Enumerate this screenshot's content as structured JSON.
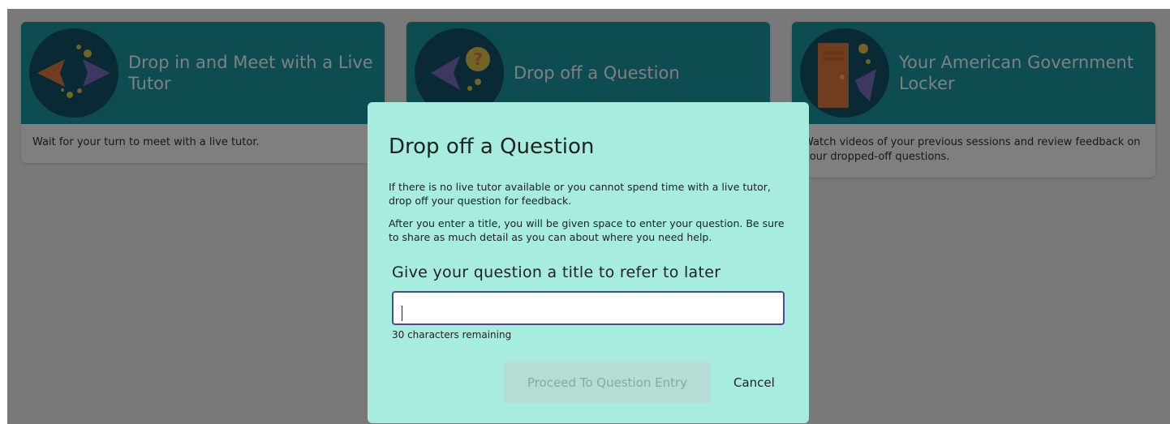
{
  "cards": [
    {
      "title": "Drop in and Meet with a Live Tutor",
      "description": "Wait for your turn to meet with a live tutor.",
      "icon": "fish-meet-icon"
    },
    {
      "title": "Drop off a Question",
      "description": "",
      "icon": "question-fish-icon"
    },
    {
      "title": "Your American Government Locker",
      "description": "Watch videos of your previous sessions and review feedback on your dropped-off questions.",
      "icon": "locker-icon"
    }
  ],
  "modal": {
    "title": "Drop off a Question",
    "paragraph1": "If there is no live tutor available or you cannot spend time with a live tutor, drop off your question for feedback.",
    "paragraph2": "After you enter a title, you will be given space to enter your question. Be sure to share as much detail as you can about where you need help.",
    "field_label": "Give your question a title to refer to later",
    "field_value": "",
    "remaining": "30 characters remaining",
    "proceed_label": "Proceed To Question Entry",
    "cancel_label": "Cancel"
  },
  "colors": {
    "card_header": "#1a9aa4",
    "icon_circle": "#12526a",
    "modal_background": "#a6ecdf",
    "input_border": "#4b4a8c",
    "button_disabled": "#b7dbd5"
  }
}
